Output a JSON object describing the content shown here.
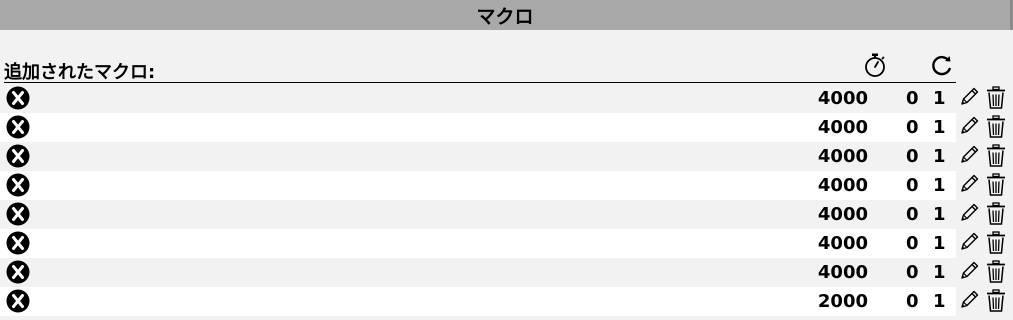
{
  "title": "マクロ",
  "added_label": "追加されたマクロ:",
  "icons": {
    "timer": "stopwatch-icon",
    "repeat": "repeat-icon",
    "remove": "remove-circle-x-icon",
    "edit": "pencil-icon",
    "delete": "trash-icon"
  },
  "macros": [
    {
      "name": "",
      "delay": "4000",
      "count": "0",
      "repeat": "1"
    },
    {
      "name": "",
      "delay": "4000",
      "count": "0",
      "repeat": "1"
    },
    {
      "name": "",
      "delay": "4000",
      "count": "0",
      "repeat": "1"
    },
    {
      "name": "",
      "delay": "4000",
      "count": "0",
      "repeat": "1"
    },
    {
      "name": "",
      "delay": "4000",
      "count": "0",
      "repeat": "1"
    },
    {
      "name": "",
      "delay": "4000",
      "count": "0",
      "repeat": "1"
    },
    {
      "name": "",
      "delay": "4000",
      "count": "0",
      "repeat": "1"
    },
    {
      "name": "",
      "delay": "2000",
      "count": "0",
      "repeat": "1"
    }
  ],
  "colors": {
    "title_bar": "#a9a9a9",
    "background": "#f2f2f2",
    "row_alt": "#ffffff"
  }
}
